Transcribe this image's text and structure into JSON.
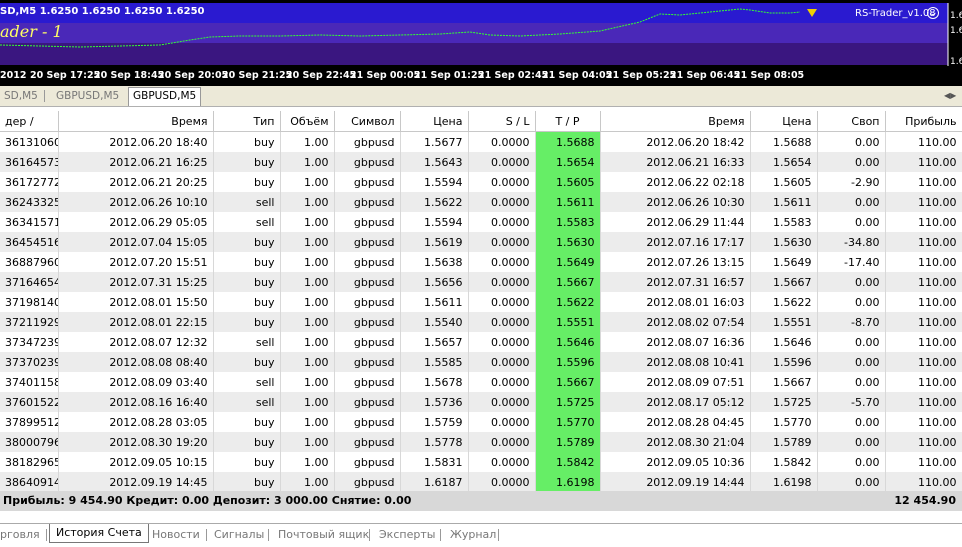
{
  "chart": {
    "title": "SD,M5  1.6250 1.6250 1.6250 1.6250",
    "ea_name": "ader - 1",
    "ea_label": "RS-Trader_v1.08",
    "price_labels": [
      "1.6",
      "1.6",
      "1.6"
    ],
    "time_labels": [
      "2012",
      "20 Sep 17:25",
      "20 Sep 18:45",
      "20 Sep 20:05",
      "20 Sep 21:25",
      "20 Sep 22:45",
      "21 Sep 00:05",
      "21 Sep 01:25",
      "21 Sep 02:45",
      "21 Sep 04:05",
      "21 Sep 05:25",
      "21 Sep 06:45",
      "21 Sep 08:05"
    ]
  },
  "chart_tabs": [
    "SD,M5",
    "GBPUSD,M5",
    "GBPUSD,M5"
  ],
  "columns": [
    "дер  /",
    "Время",
    "Тип",
    "Объём",
    "Символ",
    "Цена",
    "S / L",
    "T / P",
    "Время",
    "Цена",
    "Своп",
    "Прибыль"
  ],
  "rows": [
    [
      "36131060",
      "2012.06.20 18:40",
      "buy",
      "1.00",
      "gbpusd",
      "1.5677",
      "0.0000",
      "1.5688",
      "2012.06.20 18:42",
      "1.5688",
      "0.00",
      "110.00"
    ],
    [
      "36164573",
      "2012.06.21 16:25",
      "buy",
      "1.00",
      "gbpusd",
      "1.5643",
      "0.0000",
      "1.5654",
      "2012.06.21 16:33",
      "1.5654",
      "0.00",
      "110.00"
    ],
    [
      "36172772",
      "2012.06.21 20:25",
      "buy",
      "1.00",
      "gbpusd",
      "1.5594",
      "0.0000",
      "1.5605",
      "2012.06.22 02:18",
      "1.5605",
      "-2.90",
      "110.00"
    ],
    [
      "36243325",
      "2012.06.26 10:10",
      "sell",
      "1.00",
      "gbpusd",
      "1.5622",
      "0.0000",
      "1.5611",
      "2012.06.26 10:30",
      "1.5611",
      "0.00",
      "110.00"
    ],
    [
      "36341571",
      "2012.06.29 05:05",
      "sell",
      "1.00",
      "gbpusd",
      "1.5594",
      "0.0000",
      "1.5583",
      "2012.06.29 11:44",
      "1.5583",
      "0.00",
      "110.00"
    ],
    [
      "36454516",
      "2012.07.04 15:05",
      "buy",
      "1.00",
      "gbpusd",
      "1.5619",
      "0.0000",
      "1.5630",
      "2012.07.16 17:17",
      "1.5630",
      "-34.80",
      "110.00"
    ],
    [
      "36887960",
      "2012.07.20 15:51",
      "buy",
      "1.00",
      "gbpusd",
      "1.5638",
      "0.0000",
      "1.5649",
      "2012.07.26 13:15",
      "1.5649",
      "-17.40",
      "110.00"
    ],
    [
      "37164654",
      "2012.07.31 15:25",
      "buy",
      "1.00",
      "gbpusd",
      "1.5656",
      "0.0000",
      "1.5667",
      "2012.07.31 16:57",
      "1.5667",
      "0.00",
      "110.00"
    ],
    [
      "37198140",
      "2012.08.01 15:50",
      "buy",
      "1.00",
      "gbpusd",
      "1.5611",
      "0.0000",
      "1.5622",
      "2012.08.01 16:03",
      "1.5622",
      "0.00",
      "110.00"
    ],
    [
      "37211929",
      "2012.08.01 22:15",
      "buy",
      "1.00",
      "gbpusd",
      "1.5540",
      "0.0000",
      "1.5551",
      "2012.08.02 07:54",
      "1.5551",
      "-8.70",
      "110.00"
    ],
    [
      "37347239",
      "2012.08.07 12:32",
      "sell",
      "1.00",
      "gbpusd",
      "1.5657",
      "0.0000",
      "1.5646",
      "2012.08.07 16:36",
      "1.5646",
      "0.00",
      "110.00"
    ],
    [
      "37370239",
      "2012.08.08 08:40",
      "buy",
      "1.00",
      "gbpusd",
      "1.5585",
      "0.0000",
      "1.5596",
      "2012.08.08 10:41",
      "1.5596",
      "0.00",
      "110.00"
    ],
    [
      "37401158",
      "2012.08.09 03:40",
      "sell",
      "1.00",
      "gbpusd",
      "1.5678",
      "0.0000",
      "1.5667",
      "2012.08.09 07:51",
      "1.5667",
      "0.00",
      "110.00"
    ],
    [
      "37601522",
      "2012.08.16 16:40",
      "sell",
      "1.00",
      "gbpusd",
      "1.5736",
      "0.0000",
      "1.5725",
      "2012.08.17 05:12",
      "1.5725",
      "-5.70",
      "110.00"
    ],
    [
      "37899512",
      "2012.08.28 03:05",
      "buy",
      "1.00",
      "gbpusd",
      "1.5759",
      "0.0000",
      "1.5770",
      "2012.08.28 04:45",
      "1.5770",
      "0.00",
      "110.00"
    ],
    [
      "38000796",
      "2012.08.30 19:20",
      "buy",
      "1.00",
      "gbpusd",
      "1.5778",
      "0.0000",
      "1.5789",
      "2012.08.30 21:04",
      "1.5789",
      "0.00",
      "110.00"
    ],
    [
      "38182965",
      "2012.09.05 10:15",
      "buy",
      "1.00",
      "gbpusd",
      "1.5831",
      "0.0000",
      "1.5842",
      "2012.09.05 10:36",
      "1.5842",
      "0.00",
      "110.00"
    ],
    [
      "38640914",
      "2012.09.19 14:45",
      "buy",
      "1.00",
      "gbpusd",
      "1.6187",
      "0.0000",
      "1.6198",
      "2012.09.19 14:44",
      "1.6198",
      "0.00",
      "110.00"
    ]
  ],
  "summary": {
    "left": "Прибыль: 9 454.90  Кредит: 0.00  Депозит: 3 000.00  Снятие: 0.00",
    "right": "12 454.90"
  },
  "bottom_tabs": [
    "рговля",
    "История Счета",
    "Новости",
    "Сигналы",
    "Почтовый ящик",
    "Эксперты",
    "Журнал"
  ],
  "colors": {
    "tp_highlight": "#66ee66",
    "chart_bg": "#000000",
    "chart_band": "#3a1a8a",
    "price_line": "#33ff33"
  }
}
